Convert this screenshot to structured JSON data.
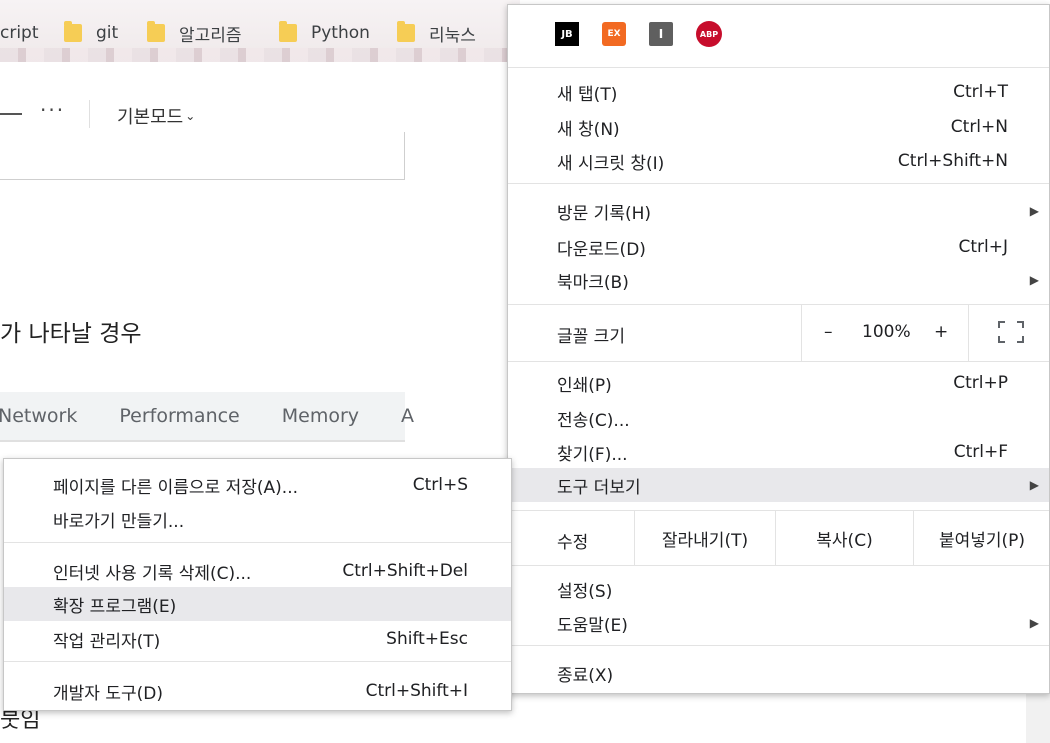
{
  "bookmarks": [
    {
      "label": "cript",
      "type": "link"
    },
    {
      "label": "git",
      "type": "folder"
    },
    {
      "label": "알고리즘",
      "type": "folder"
    },
    {
      "label": "Python",
      "type": "folder"
    },
    {
      "label": "리눅스",
      "type": "folder"
    }
  ],
  "editor": {
    "more_dots": "···",
    "mode_label": "기본모드",
    "mode_chevron": "⌄",
    "heading_fragment": "가 나타날 경우",
    "bottom_fragment": "붓임"
  },
  "devtools": {
    "tabs": [
      "Network",
      "Performance",
      "Memory",
      "A"
    ]
  },
  "chrome_menu": {
    "extensions": [
      {
        "name": "jetbrains-icon",
        "text": "JB",
        "color": "#000000"
      },
      {
        "name": "ex-extension-icon",
        "text": "EX",
        "color": "#f26a22"
      },
      {
        "name": "i-extension-icon",
        "text": "I",
        "color": "#5f5f5f"
      },
      {
        "name": "adblock-plus-icon",
        "text": "ABP",
        "color": "#c70d2c"
      }
    ],
    "items": {
      "new_tab": {
        "label": "새 탭(T)",
        "shortcut": "Ctrl+T"
      },
      "new_window": {
        "label": "새 창(N)",
        "shortcut": "Ctrl+N"
      },
      "incognito": {
        "label": "새 시크릿 창(I)",
        "shortcut": "Ctrl+Shift+N"
      },
      "history": {
        "label": "방문 기록(H)"
      },
      "downloads": {
        "label": "다운로드(D)",
        "shortcut": "Ctrl+J"
      },
      "bookmarks": {
        "label": "북마크(B)"
      },
      "print": {
        "label": "인쇄(P)",
        "shortcut": "Ctrl+P"
      },
      "cast": {
        "label": "전송(C)..."
      },
      "find": {
        "label": "찾기(F)...",
        "shortcut": "Ctrl+F"
      },
      "more_tools": {
        "label": "도구 더보기"
      },
      "settings": {
        "label": "설정(S)"
      },
      "help": {
        "label": "도움말(E)"
      },
      "exit": {
        "label": "종료(X)"
      }
    },
    "zoom": {
      "label": "글꼴 크기",
      "minus": "–",
      "value": "100%",
      "plus": "+"
    },
    "edit": {
      "label": "수정",
      "cut": "잘라내기(T)",
      "copy": "복사(C)",
      "paste": "붙여넣기(P)"
    },
    "submenu_arrow": "▶"
  },
  "more_tools_menu": {
    "save_as": {
      "label": "페이지를 다른 이름으로 저장(A)...",
      "shortcut": "Ctrl+S"
    },
    "create_shortcut": {
      "label": "바로가기 만들기..."
    },
    "clear_data": {
      "label": "인터넷 사용 기록 삭제(C)...",
      "shortcut": "Ctrl+Shift+Del"
    },
    "extensions": {
      "label": "확장 프로그램(E)"
    },
    "task_manager": {
      "label": "작업 관리자(T)",
      "shortcut": "Shift+Esc"
    },
    "dev_tools": {
      "label": "개발자 도구(D)",
      "shortcut": "Ctrl+Shift+I"
    }
  }
}
